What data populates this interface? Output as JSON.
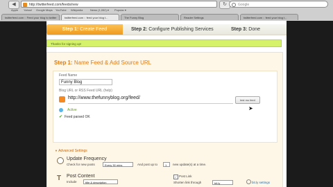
{
  "browser": {
    "url": "http://twitterfeed.com/feeds/new",
    "search_placeholder": "Google",
    "bookmarks": [
      "Apple",
      "Yahoo!",
      "Google Maps",
      "YouTube",
      "Wikipedia",
      "News (1,052) ▾",
      "Popular ▾"
    ],
    "tabs": [
      "twitterfeed.com :: Feed your blog to twitter",
      "twitterfeed.com :: feed your blog t...",
      "The Funny Blog",
      "Reader Settings",
      "twitterfeed.com :: feed your blog t..."
    ]
  },
  "steps": {
    "step1_prefix": "Step 1:",
    "step1_text": "Create Feed",
    "step2_prefix": "Step 2:",
    "step2_text": "Configure Publishing Services",
    "step3_prefix": "Step 3:",
    "step3_text": "Done"
  },
  "notice": "Thanks for signing up!",
  "panel": {
    "title_prefix": "Step 1:",
    "title_text": "Name Feed & Add Source URL",
    "feed_name_label": "Feed Name",
    "feed_name_value": "Funny Blog",
    "blog_url_label": "Blog URL or RSS Feed URL (help)",
    "blog_url_value": "http://www.thefunnyblog.org/feed/",
    "test_button": "test rss feed",
    "active_label": "Active",
    "parsed_label": "Feed parsed OK"
  },
  "advanced": {
    "label": "Advanced Settings",
    "update_title": "Update Frequency",
    "check_label": "Check for new posts",
    "check_value": "Every 30 mins",
    "post_label": "And post up to",
    "post_value": "1",
    "post_suffix": "new update(s) at a time.",
    "content_title": "Post Content",
    "include_label": "Include",
    "include_value": "title & description",
    "post_link_label": "Post Link",
    "shorten_label": "Shorten link through",
    "shorten_value": "bit.ly",
    "settings_label": "bit.ly settings"
  },
  "colors": {
    "step_active": "#f09a1c",
    "notice_bg": "#d6f26b",
    "panel_bg": "#fef6e6",
    "title_orange": "#e07b12"
  }
}
